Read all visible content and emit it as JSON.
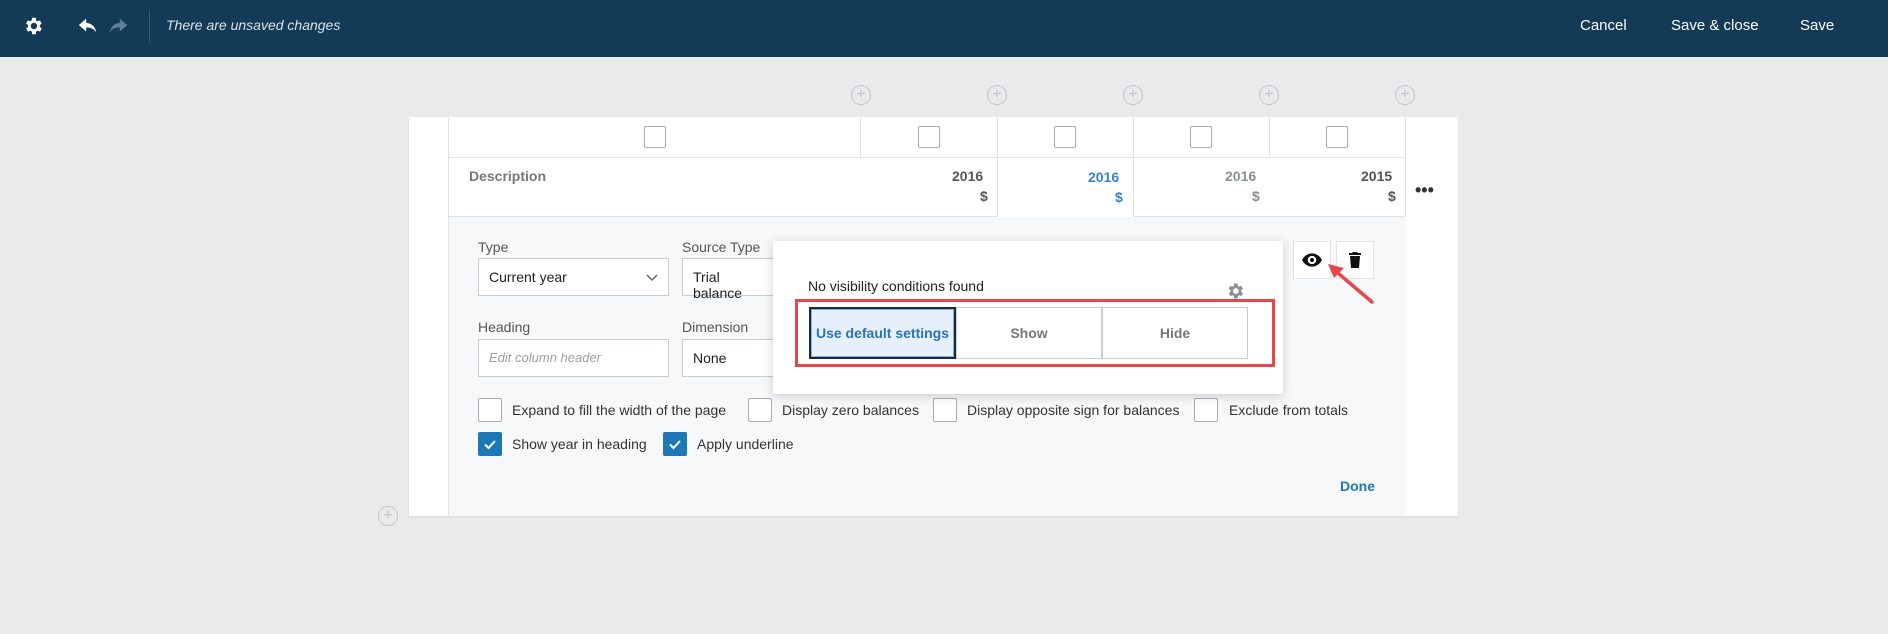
{
  "topbar": {
    "status": "There are unsaved changes",
    "cancel_label": "Cancel",
    "save_close_label": "Save & close",
    "save_label": "Save",
    "icons": [
      "gear-icon",
      "undo-icon",
      "redo-icon"
    ]
  },
  "table": {
    "header": {
      "description": "Description",
      "columns": [
        {
          "year": "2016",
          "unit": "$"
        },
        {
          "year": "2016",
          "unit": "$"
        },
        {
          "year": "2016",
          "unit": "$"
        },
        {
          "year": "2015",
          "unit": "$"
        }
      ]
    }
  },
  "editor": {
    "type_label": "Type",
    "type_value": "Current year",
    "source_type_label": "Source Type",
    "source_type_value": "Trial balance",
    "heading_label": "Heading",
    "heading_placeholder": "Edit column header",
    "dimension_label": "Dimension",
    "dimension_value": "None",
    "options": [
      {
        "label": "Expand to fill the width of the page",
        "checked": false
      },
      {
        "label": "Display zero balances",
        "checked": false
      },
      {
        "label": "Display opposite sign for balances",
        "checked": false
      },
      {
        "label": "Exclude from totals",
        "checked": false
      },
      {
        "label": "Show year in heading",
        "checked": true
      },
      {
        "label": "Apply underline",
        "checked": true
      }
    ],
    "done_label": "Done"
  },
  "visibility_popover": {
    "title": "No visibility conditions found",
    "default_label": "Use default settings",
    "show_label": "Show",
    "hide_label": "Hide",
    "selected": "Use default settings"
  },
  "colors": {
    "topbar": "#133a56",
    "accent": "#1e78b8",
    "highlight": "#e5474b"
  }
}
